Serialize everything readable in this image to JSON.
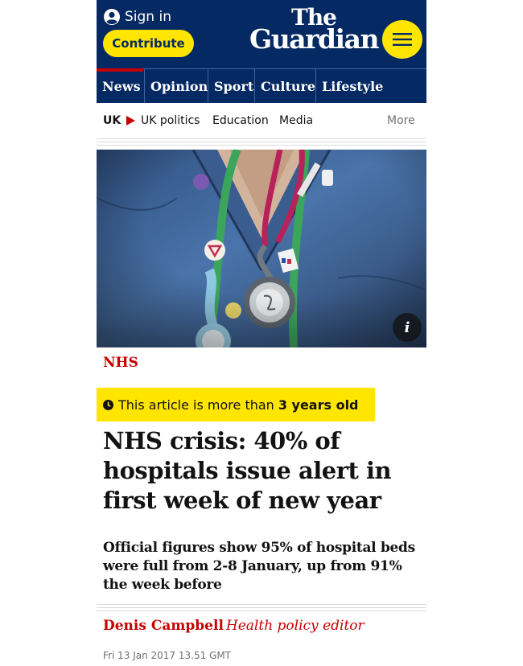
{
  "header": {
    "sign_in_label": "Sign in",
    "contribute_label": "Contribute",
    "logo_line1": "The",
    "logo_line2": "Guardian",
    "menu_icon": "hamburger-menu-icon"
  },
  "pillars": [
    "News",
    "Opinion",
    "Sport",
    "Culture",
    "Lifestyle"
  ],
  "subnav": {
    "items": [
      "UK",
      "UK politics",
      "Education",
      "Media"
    ],
    "more_label": "More"
  },
  "article": {
    "kicker": "NHS",
    "age_warning": {
      "prefix": "This article is more than",
      "value": "3 years old"
    },
    "headline": "NHS crisis: 40% of hospitals issue alert in first week of new year",
    "standfirst": "Official figures show 95% of hospital beds were full from 2-8 January, up from 91% the week before",
    "byline": {
      "name": "Denis Campbell",
      "role": "Health policy editor"
    },
    "date": "Fri 13 Jan 2017 13.51 GMT"
  },
  "colors": {
    "brand_blue": "#052962",
    "accent_red": "#c70000",
    "highlight_yellow": "#ffe500"
  }
}
